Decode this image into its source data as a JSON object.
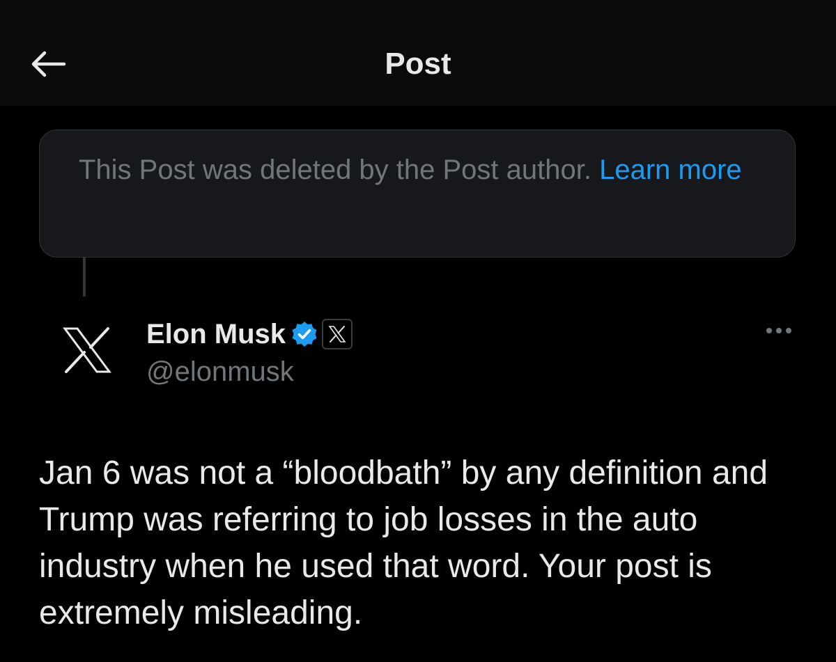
{
  "header": {
    "title": "Post",
    "back_icon": "arrow-left-icon"
  },
  "deleted_notice": {
    "text": "This Post was deleted by the Post author.",
    "link_label": "Learn more",
    "link_color": "#1d9bf0"
  },
  "post": {
    "avatar_icon": "x-logo-icon",
    "author_name": "Elon Musk",
    "verified_icon": "verified-badge-icon",
    "affiliate_icon": "x-affiliate-badge-icon",
    "author_handle": "@elonmusk",
    "more_icon": "more-options-icon",
    "text": "Jan 6 was not a “bloodbath” by any definition and Trump was referring to job losses in the auto industry when he used that word. Your post is extremely misleading."
  },
  "colors": {
    "background": "#000000",
    "header_background": "#0b0b0b",
    "primary_text": "#e7e9ea",
    "secondary_text": "#71767b",
    "accent": "#1d9bf0",
    "notice_background": "#16181c",
    "border": "#2f3336"
  }
}
